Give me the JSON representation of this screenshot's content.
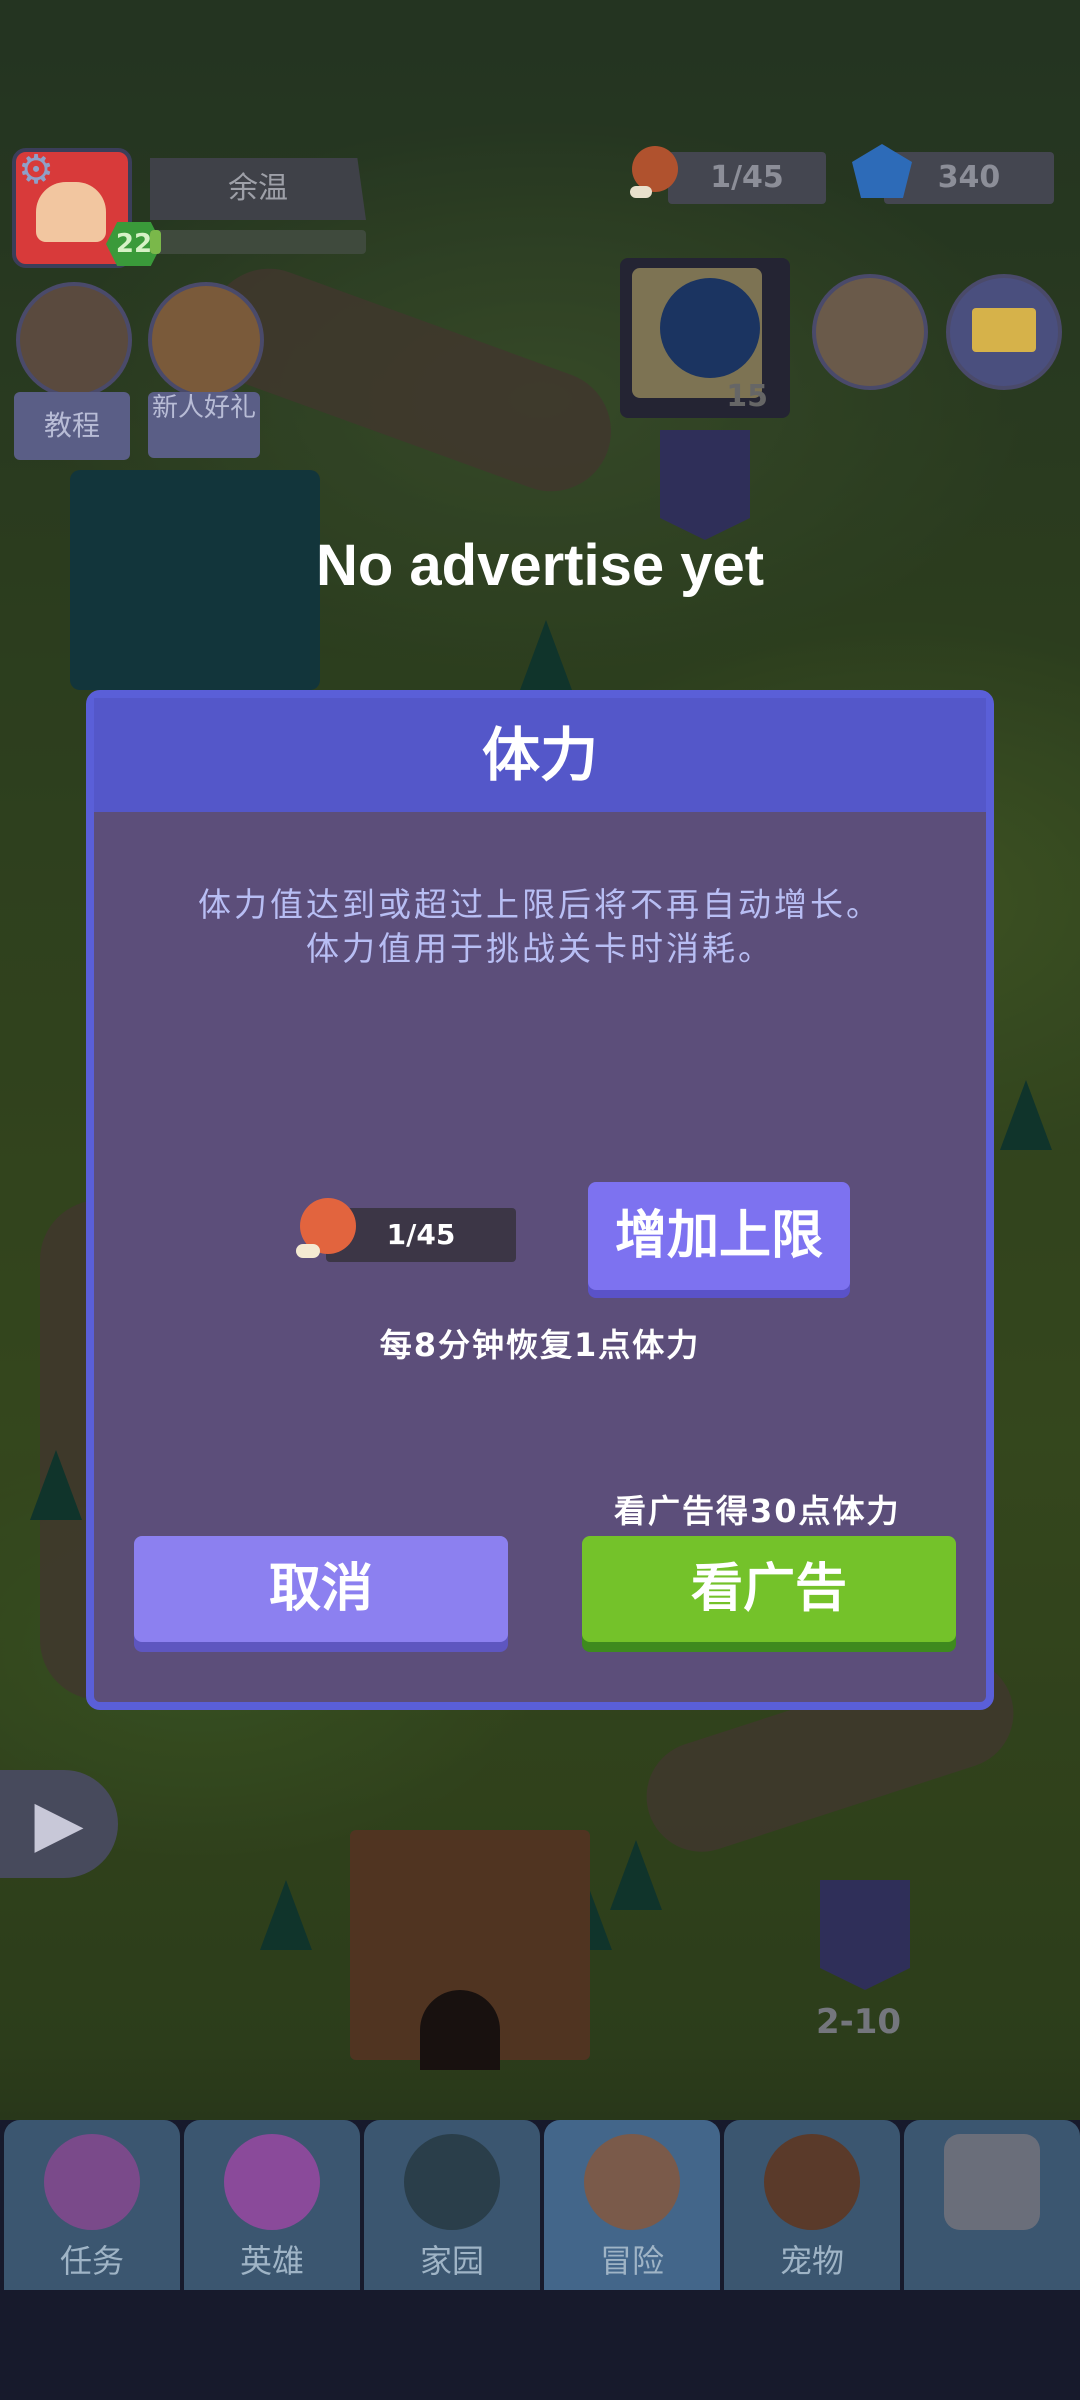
{
  "player": {
    "name": "余温",
    "level": "22",
    "xp_fraction": 0.05
  },
  "resources": {
    "stamina": "1/45",
    "gems": "340"
  },
  "shortcuts": {
    "tutorial": "教程",
    "newbie_gift": "新人好礼"
  },
  "map": {
    "chest_count": "15",
    "stage_label": "2-10"
  },
  "toast": "No advertise yet",
  "dialog": {
    "title": "体力",
    "description_line1": "体力值达到或超过上限后将不再自动增长。",
    "description_line2": "体力值用于挑战关卡时消耗。",
    "stamina_value": "1/45",
    "increase_limit_label": "增加上限",
    "regen_text": "每8分钟恢复1点体力",
    "ad_hint": "看广告得30点体力",
    "cancel_label": "取消",
    "watch_ad_label": "看广告"
  },
  "nav": {
    "tabs": [
      {
        "label": "任务",
        "icon": "task-icon"
      },
      {
        "label": "英雄",
        "icon": "hero-icon"
      },
      {
        "label": "家园",
        "icon": "home-icon"
      },
      {
        "label": "冒险",
        "icon": "adventure-icon"
      },
      {
        "label": "宠物",
        "icon": "pet-icon"
      },
      {
        "label": "",
        "icon": "lock-icon"
      }
    ],
    "active_index": 3
  },
  "colors": {
    "dialog_bg": "#5c4e7a",
    "dialog_header": "#5457c9",
    "button_purple": "#8c80f0",
    "button_green": "#74c22a"
  }
}
